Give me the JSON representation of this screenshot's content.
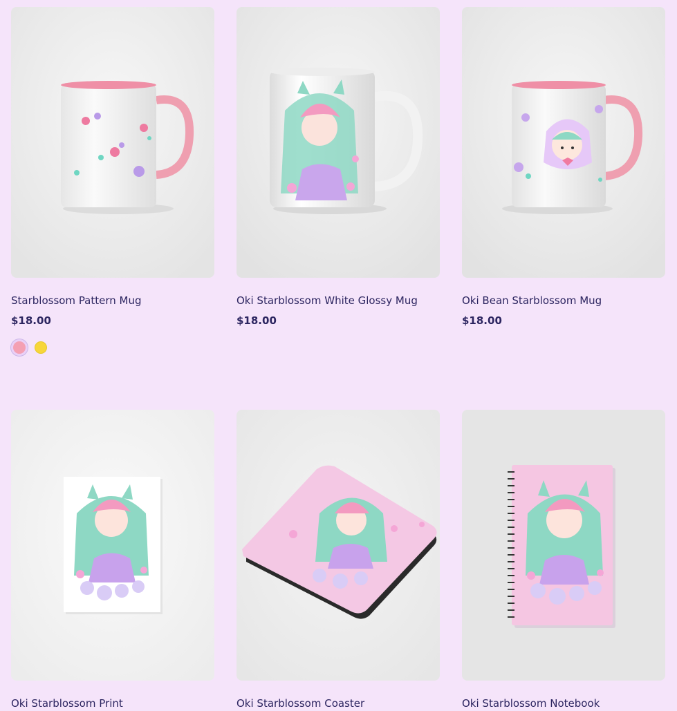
{
  "products": [
    {
      "title": "Starblossom Pattern Mug",
      "price": "$18.00",
      "image": "pink-handle-mug-flower-pattern",
      "swatches": [
        {
          "name": "pink-swatch",
          "color": "#f4a0b3"
        },
        {
          "name": "yellow-swatch",
          "color": "#f7d63a"
        }
      ]
    },
    {
      "title": "Oki Starblossom White Glossy Mug",
      "price": "$18.00",
      "image": "white-glossy-mug-character"
    },
    {
      "title": "Oki Bean Starblossom Mug",
      "price": "$18.00",
      "image": "pink-handle-mug-chibi"
    },
    {
      "title": "Oki Starblossom Print",
      "image": "art-print"
    },
    {
      "title": "Oki Starblossom Coaster",
      "image": "coaster"
    },
    {
      "title": "Oki Starblossom Notebook",
      "image": "spiral-notebook"
    }
  ],
  "colors": {
    "background": "#f5e4fa",
    "text": "#2c2560"
  }
}
